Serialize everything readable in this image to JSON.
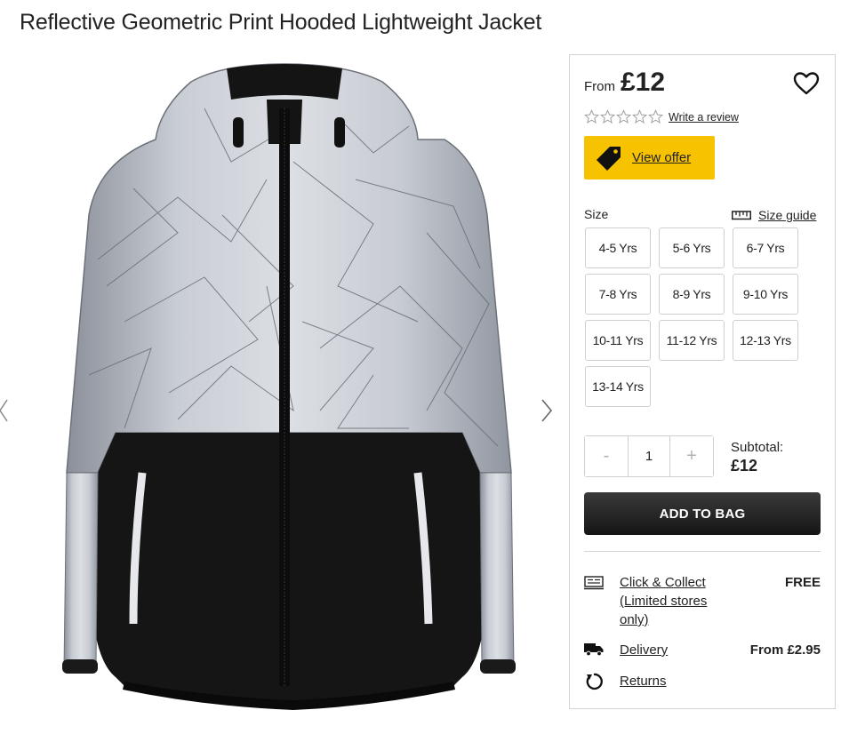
{
  "product": {
    "title": "Reflective Geometric Print Hooded Lightweight Jacket"
  },
  "gallery": {
    "image_icon": "reflective-jacket-image",
    "prev_icon": "chevron-left-icon",
    "next_icon": "chevron-right-icon"
  },
  "price": {
    "from_label": "From",
    "value": "£12"
  },
  "wishlist": {
    "icon": "heart-icon"
  },
  "rating": {
    "stars_filled": 0,
    "stars_total": 5,
    "write_review_label": "Write a review"
  },
  "offer": {
    "label": "View offer",
    "icon": "tag-icon",
    "color": "#f7c200"
  },
  "size": {
    "label": "Size",
    "guide_label": "Size guide",
    "guide_icon": "ruler-icon",
    "options": [
      "4-5 Yrs",
      "5-6 Yrs",
      "6-7 Yrs",
      "7-8 Yrs",
      "8-9 Yrs",
      "9-10 Yrs",
      "10-11 Yrs",
      "11-12 Yrs",
      "12-13 Yrs",
      "13-14 Yrs"
    ]
  },
  "quantity": {
    "decrement_label": "-",
    "value": "1",
    "increment_label": "+"
  },
  "subtotal": {
    "label": "Subtotal:",
    "value": "£12"
  },
  "add_to_bag": {
    "label": "ADD TO BAG"
  },
  "services": {
    "collect": {
      "icon": "click-collect-icon",
      "link_label": "Click & Collect (Limited stores only)",
      "value": "FREE"
    },
    "delivery": {
      "icon": "truck-icon",
      "link_label": "Delivery",
      "value": "From £2.95"
    },
    "returns": {
      "icon": "returns-icon",
      "link_label": "Returns"
    }
  }
}
